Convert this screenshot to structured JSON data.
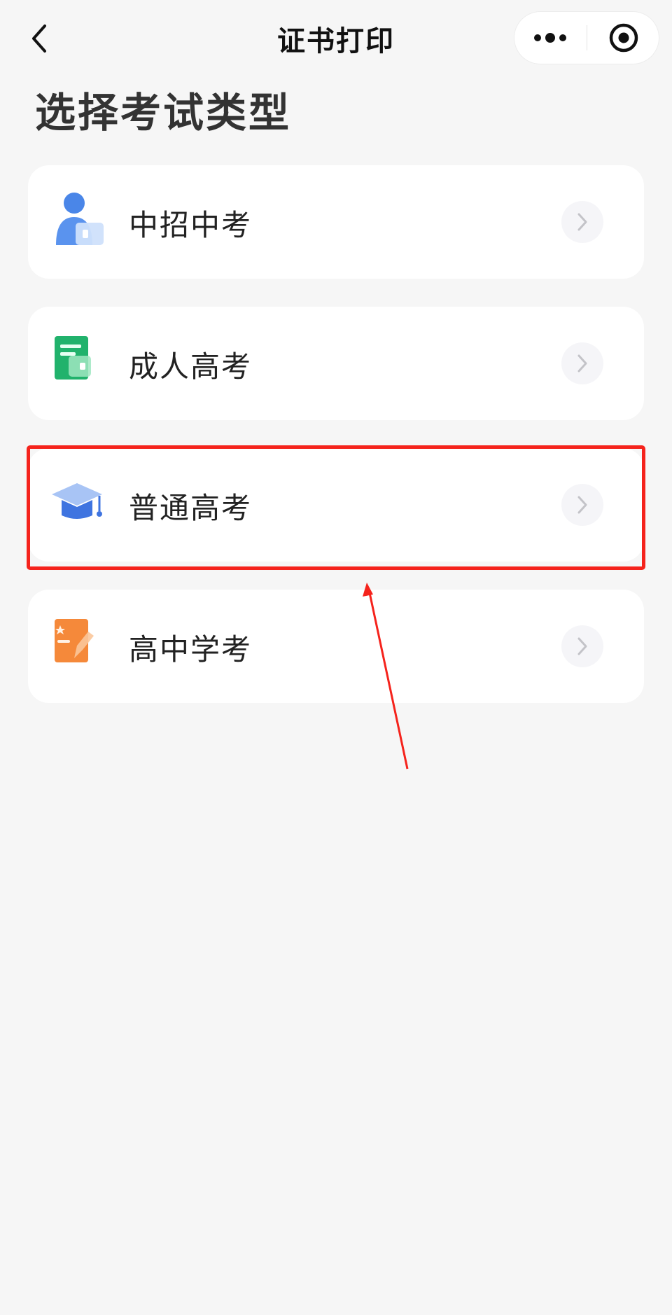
{
  "navbar": {
    "title": "证书打印",
    "back_icon": "chevron-left-icon",
    "more_icon": "more-dots-icon",
    "close_icon": "target-circle-icon"
  },
  "page_title": "选择考试类型",
  "exam_types": [
    {
      "label": "中招中考",
      "icon": "person-card-icon",
      "color": "#4a86e8"
    },
    {
      "label": "成人高考",
      "icon": "notebook-icon",
      "color": "#21b26c"
    },
    {
      "label": "普通高考",
      "icon": "graduation-cap-icon",
      "color": "#3f74e0"
    },
    {
      "label": "高中学考",
      "icon": "pencil-paper-icon",
      "color": "#f5893a"
    }
  ],
  "annotation": {
    "highlight_color": "#f5231c"
  }
}
